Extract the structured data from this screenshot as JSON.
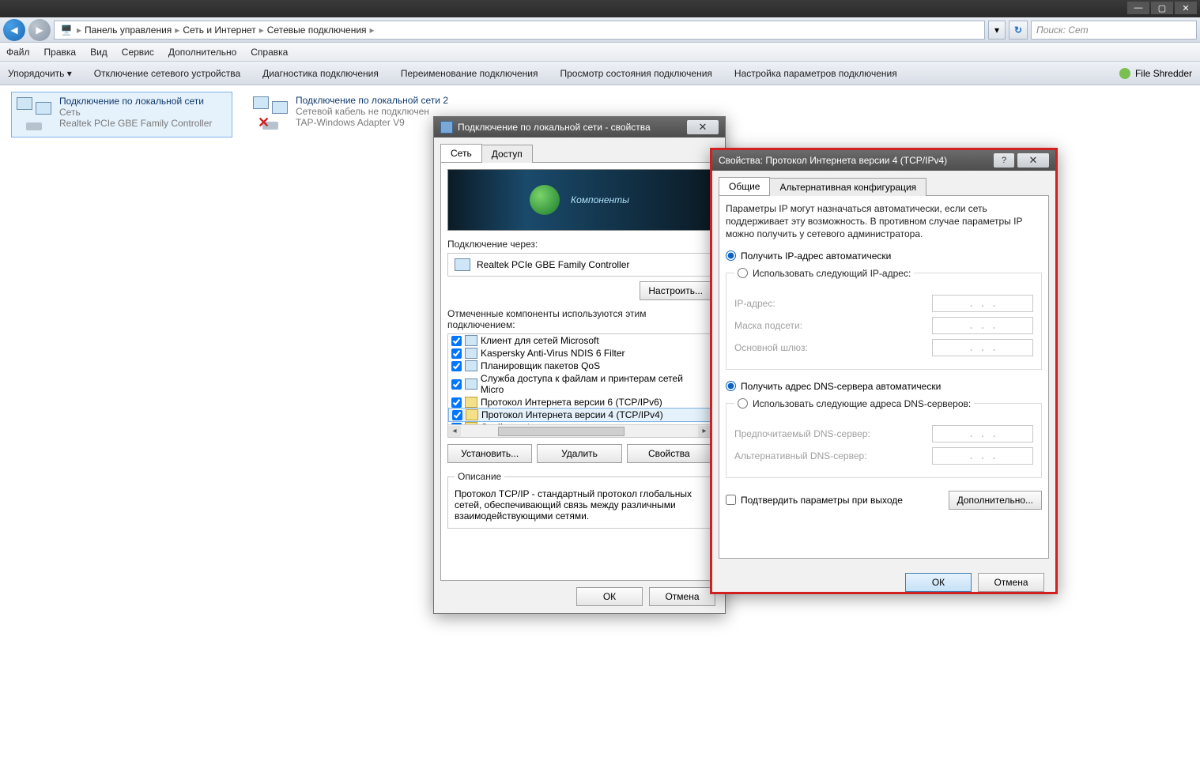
{
  "browser": {
    "minimize": "—",
    "maximize": "▢",
    "close": "✕"
  },
  "nav": {
    "crumbs": [
      "Панель управления",
      "Сеть и Интернет",
      "Сетевые подключения"
    ],
    "search_placeholder": "Поиск: Сет"
  },
  "menu": {
    "items": [
      "Файл",
      "Правка",
      "Вид",
      "Сервис",
      "Дополнительно",
      "Справка"
    ]
  },
  "toolbar": {
    "items": [
      "Упорядочить ▾",
      "Отключение сетевого устройства",
      "Диагностика подключения",
      "Переименование подключения",
      "Просмотр состояния подключения",
      "Настройка параметров подключения"
    ],
    "right_label": "File Shredder"
  },
  "connections": [
    {
      "title": "Подключение по локальной сети",
      "line2": "Сеть",
      "line3": "Realtek PCIe GBE Family Controller",
      "selected": true,
      "disconnected": false
    },
    {
      "title": "Подключение по локальной сети 2",
      "line2": "Сетевой кабель не подключен",
      "line3": "TAP-Windows Adapter V9",
      "selected": false,
      "disconnected": true
    }
  ],
  "dlg1": {
    "title": "Подключение по локальной сети - свойства",
    "tabs": [
      "Сеть",
      "Доступ"
    ],
    "banner": "Компоненты",
    "connect_via_lbl": "Подключение через:",
    "adapter": "Realtek PCIe GBE Family Controller",
    "configure_btn": "Настроить...",
    "components_lbl": "Отмеченные компоненты используются этим подключением:",
    "components": [
      "Клиент для сетей Microsoft",
      "Kaspersky Anti-Virus NDIS 6 Filter",
      "Планировщик пакетов QoS",
      "Служба доступа к файлам и принтерам сетей Micro",
      "Протокол Интернета версии 6 (TCP/IPv6)",
      "Протокол Интернета версии 4 (TCP/IPv4)",
      "Драйвер в/в тополога канального уровня"
    ],
    "selected_index": 5,
    "install_btn": "Установить...",
    "remove_btn": "Удалить",
    "props_btn": "Свойства",
    "desc_legend": "Описание",
    "desc_text": "Протокол TCP/IP - стандартный протокол глобальных сетей, обеспечивающий связь между различными взаимодействующими сетями.",
    "ok": "ОК",
    "cancel": "Отмена"
  },
  "dlg2": {
    "title": "Свойства: Протокол Интернета версии 4 (TCP/IPv4)",
    "tabs": [
      "Общие",
      "Альтернативная конфигурация"
    ],
    "desc": "Параметры IP могут назначаться автоматически, если сеть поддерживает эту возможность. В противном случае параметры IP можно получить у сетевого администратора.",
    "r_ip_auto": "Получить IP-адрес автоматически",
    "r_ip_manual": "Использовать следующий IP-адрес:",
    "lbl_ip": "IP-адрес:",
    "lbl_mask": "Маска подсети:",
    "lbl_gw": "Основной шлюз:",
    "r_dns_auto": "Получить адрес DNS-сервера автоматически",
    "r_dns_manual": "Использовать следующие адреса DNS-серверов:",
    "lbl_dns1": "Предпочитаемый DNS-сервер:",
    "lbl_dns2": "Альтернативный DNS-сервер:",
    "chk_confirm": "Подтвердить параметры при выходе",
    "advanced_btn": "Дополнительно...",
    "ok": "ОК",
    "cancel": "Отмена",
    "ip_placeholder": ".       .       ."
  }
}
